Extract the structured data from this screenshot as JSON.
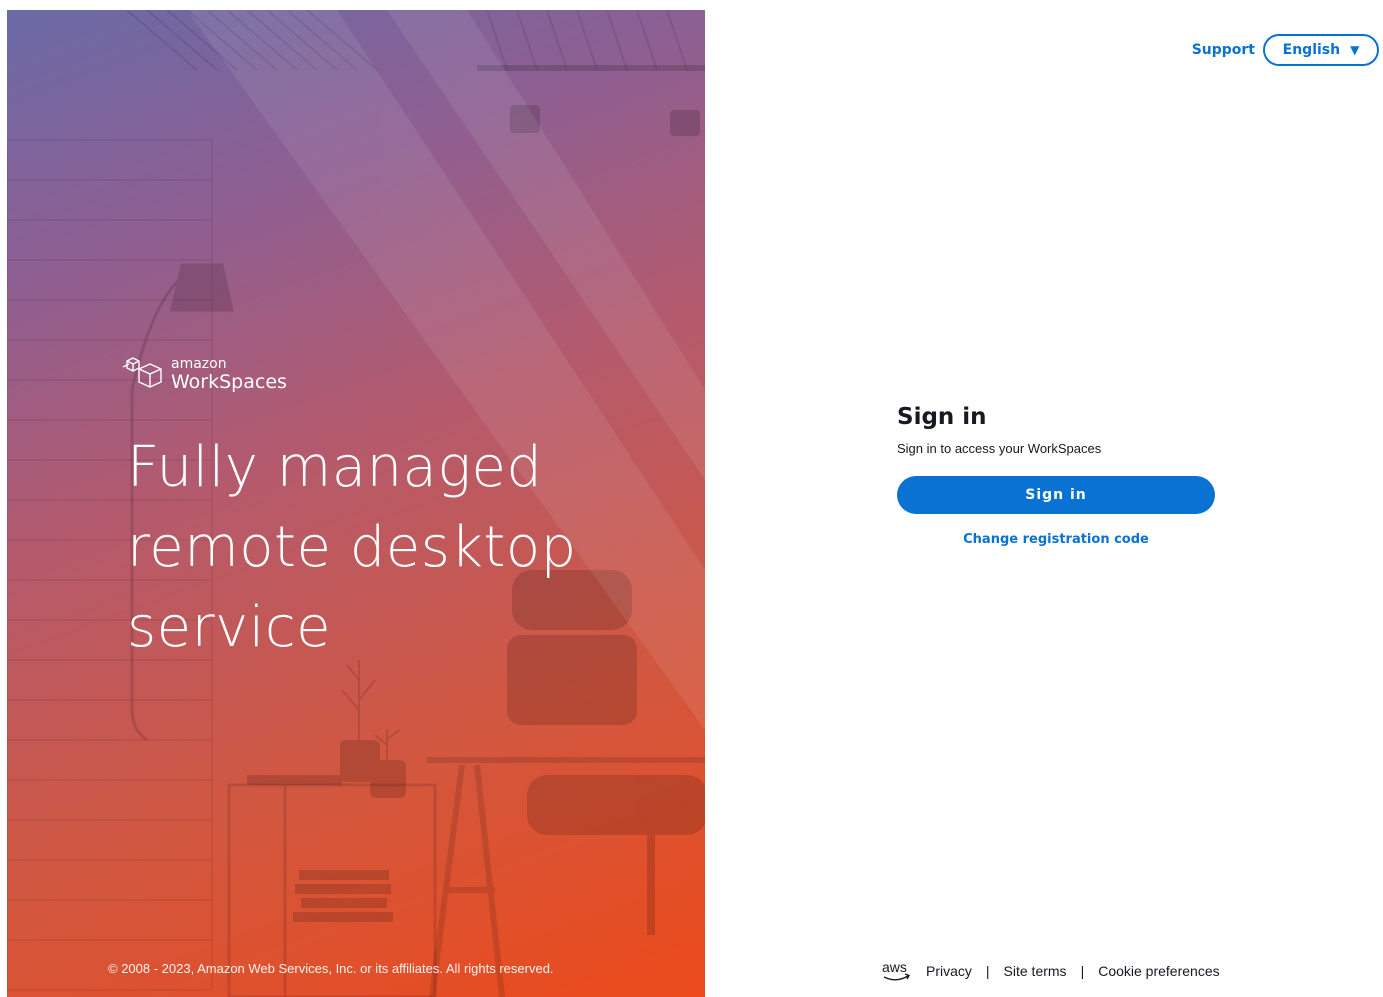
{
  "hero": {
    "brand_small": "amazon",
    "brand_large": "WorkSpaces",
    "headline_lines": [
      "Fully managed",
      "remote desktop",
      "service"
    ],
    "copyright": "© 2008 - 2023, Amazon Web Services, Inc. or its affiliates. All rights reserved.",
    "gradient_colors": [
      "#6a6aa6",
      "#b55a6c",
      "#ec4a1a"
    ]
  },
  "topbar": {
    "support_label": "Support",
    "language_label": "English",
    "language_caret": "▼"
  },
  "signin": {
    "title": "Sign in",
    "subtitle": "Sign in to access your WorkSpaces",
    "button_label": "Sign in",
    "change_code_label": "Change registration code"
  },
  "footer": {
    "logo_label": "aws",
    "links": [
      "Privacy",
      "Site terms",
      "Cookie preferences"
    ],
    "separator": "|"
  },
  "colors": {
    "accent": "#0972d3",
    "text": "#16191f",
    "background": "#ffffff"
  },
  "icons": {
    "brand_logo": "workspaces-cubes-icon",
    "language_caret": "caret-down-icon",
    "aws_logo": "aws-logo-icon"
  }
}
